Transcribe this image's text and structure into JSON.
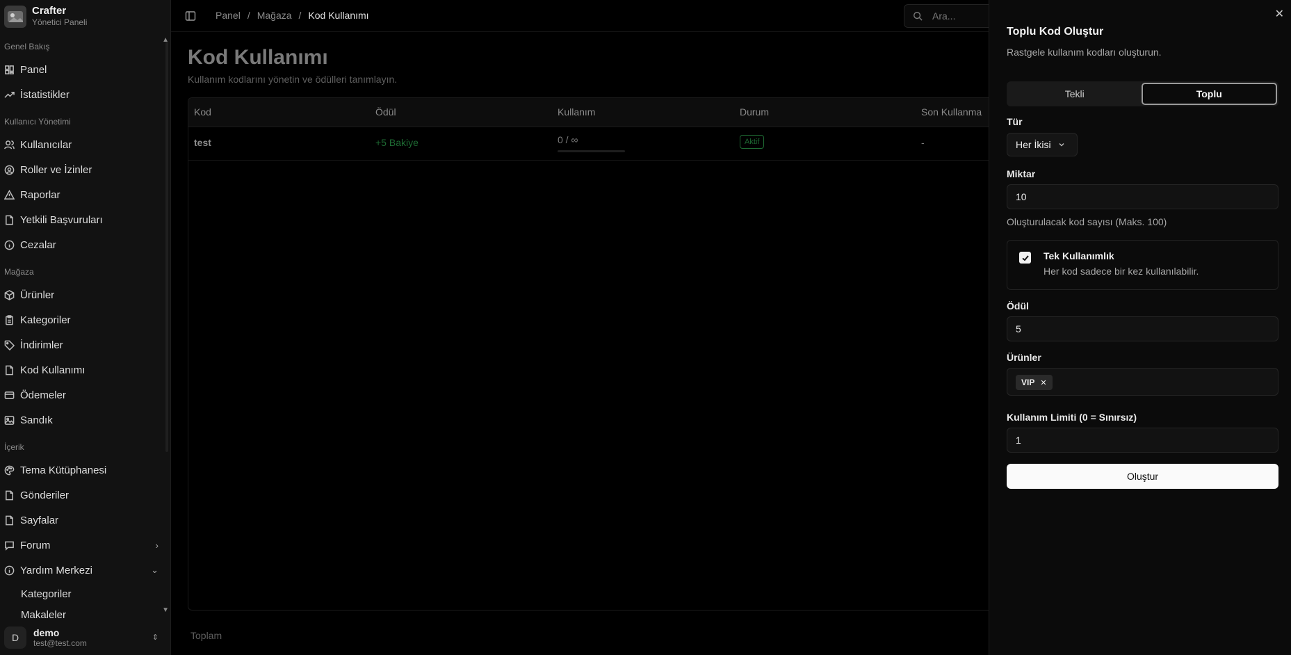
{
  "brand": {
    "name": "Crafter",
    "subtitle": "Yönetici Paneli"
  },
  "sidebar": {
    "sections": [
      {
        "label": "Genel Bakış"
      },
      {
        "label": "Kullanıcı Yönetimi"
      },
      {
        "label": "Mağaza"
      },
      {
        "label": "İçerik"
      }
    ],
    "items": [
      {
        "label": "Panel",
        "icon": "dashboard-icon"
      },
      {
        "label": "İstatistikler",
        "icon": "trending-up-icon"
      },
      {
        "label": "Kullanıcılar",
        "icon": "users-icon"
      },
      {
        "label": "Roller ve İzinler",
        "icon": "user-circle-icon"
      },
      {
        "label": "Raporlar",
        "icon": "warning-icon"
      },
      {
        "label": "Yetkili Başvuruları",
        "icon": "file-icon"
      },
      {
        "label": "Cezalar",
        "icon": "info-icon"
      },
      {
        "label": "Ürünler",
        "icon": "package-icon"
      },
      {
        "label": "Kategoriler",
        "icon": "clipboard-icon"
      },
      {
        "label": "İndirimler",
        "icon": "tag-icon"
      },
      {
        "label": "Kod Kullanımı",
        "icon": "file-icon"
      },
      {
        "label": "Ödemeler",
        "icon": "credit-card-icon"
      },
      {
        "label": "Sandık",
        "icon": "image-icon"
      },
      {
        "label": "Tema Kütüphanesi",
        "icon": "palette-icon"
      },
      {
        "label": "Gönderiler",
        "icon": "file-icon"
      },
      {
        "label": "Sayfalar",
        "icon": "file-icon"
      },
      {
        "label": "Forum",
        "icon": "message-icon"
      },
      {
        "label": "Yardım Merkezi",
        "icon": "info-icon"
      }
    ],
    "sub_items": [
      {
        "label": "Kategoriler"
      },
      {
        "label": "Makaleler"
      }
    ]
  },
  "user": {
    "initial": "D",
    "name": "demo",
    "email": "test@test.com"
  },
  "breadcrumb": {
    "items": [
      "Panel",
      "Mağaza"
    ],
    "current": "Kod Kullanımı",
    "separator": "/"
  },
  "search": {
    "placeholder": "Ara..."
  },
  "page": {
    "title": "Kod Kullanımı",
    "subtitle": "Kullanım kodlarını yönetin ve ödülleri tanımlayın."
  },
  "table": {
    "headers": [
      "Kod",
      "Ödül",
      "Kullanım",
      "Durum",
      "Son Kullanma"
    ],
    "rows": [
      {
        "code": "test",
        "reward": "+5 Bakiye",
        "usage": "0 / ∞",
        "usage_fraction": 0,
        "status": "Aktif",
        "expiry": "-"
      }
    ],
    "footer": "Toplam"
  },
  "sheet": {
    "title": "Toplu Kod Oluştur",
    "description": "Rastgele kullanım kodları oluşturun.",
    "tabs": [
      "Tekli",
      "Toplu"
    ],
    "active_tab": "Toplu",
    "type_label": "Tür",
    "type_value": "Her İkisi",
    "amount_label": "Miktar",
    "amount_value": "10",
    "amount_hint": "Oluşturulacak kod sayısı (Maks. 100)",
    "single_use_title": "Tek Kullanımlık",
    "single_use_desc": "Her kod sadece bir kez kullanılabilir.",
    "single_use_checked": true,
    "reward_label": "Ödül",
    "reward_value": "5",
    "products_label": "Ürünler",
    "products": [
      "VIP"
    ],
    "limit_label": "Kullanım Limiti (0 = Sınırsız)",
    "limit_value": "1",
    "submit_label": "Oluştur",
    "close_icon": "close-icon"
  },
  "colors": {
    "accent_green": "#1e6b33",
    "primary_button": "#fafafa"
  }
}
